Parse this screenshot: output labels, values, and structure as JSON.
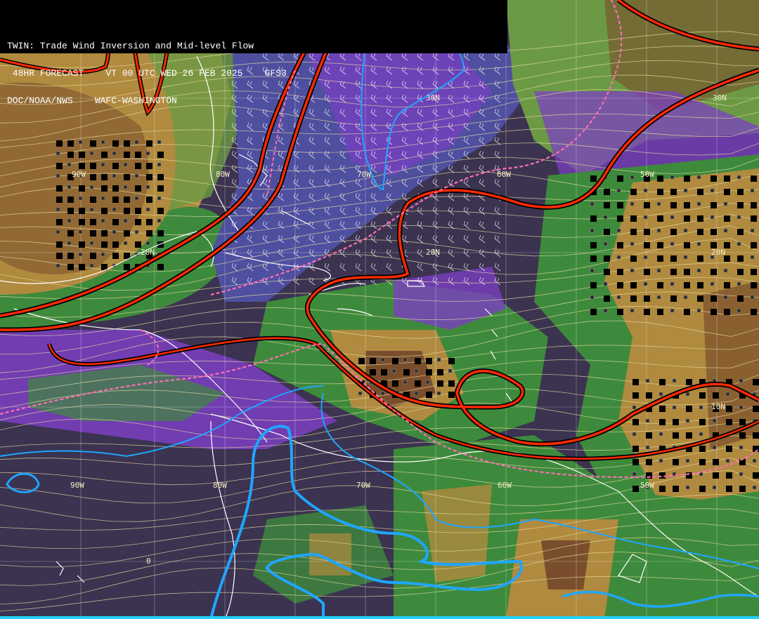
{
  "header": {
    "line1": "TWIN: Trade Wind Inversion and Mid-level Flow",
    "line2": " 48HR FORECAST    VT 00 UTC WED 26 FEB 2025    GFS3",
    "line3": "DOC/NOAA/NWS    WAFC-WASHINGTON"
  },
  "grid_labels": {
    "lat_30n_a": "30N",
    "lat_30n_b": "30N",
    "lon_90w_top": "90W",
    "lon_80w_top": "80W",
    "lon_70w_top": "70W",
    "lon_60w_top": "60W",
    "lon_50w_top": "50W",
    "lat_20n_a": "20N",
    "lat_20n_b": "20N",
    "lat_20n_c": "20N",
    "lat_10n": "10N",
    "lon_90w_bot": "90W",
    "lon_80w_bot": "80W",
    "lon_70w_bot": "70W",
    "lon_60w_bot": "60W",
    "lon_50w_bot": "50W",
    "eq": "0"
  },
  "colors": {
    "ocean_dark": "#3b3350",
    "purple": "#7b3fc2",
    "blue_band": "#4f4fa0",
    "green": "#3e8a3c",
    "light_green": "#6c9a44",
    "tan": "#b08a3e",
    "brown": "#7a4e2c",
    "inversion_red": "#ff2a00",
    "inversion_pink": "#ff6fb4",
    "cyan_contour": "#1fa6ff",
    "streamline": "#e8dca0",
    "coastline": "#ffffff"
  }
}
